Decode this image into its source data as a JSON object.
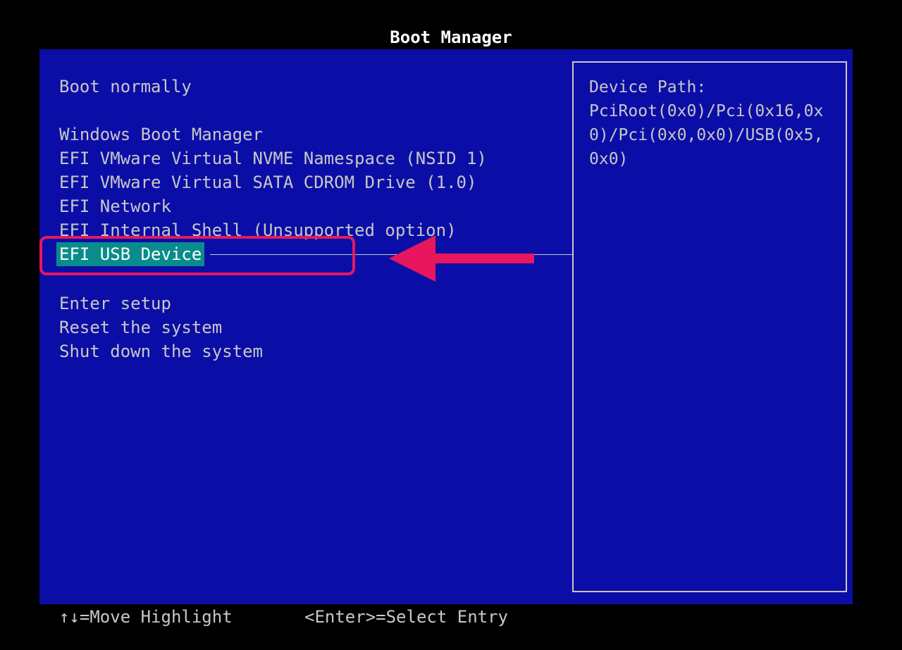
{
  "title": "Boot Manager",
  "menu": {
    "items": [
      {
        "label": "Boot normally"
      },
      {
        "label": "Windows Boot Manager"
      },
      {
        "label": "EFI VMware Virtual NVME Namespace (NSID 1)"
      },
      {
        "label": "EFI VMware Virtual SATA CDROM Drive (1.0)"
      },
      {
        "label": "EFI Network"
      },
      {
        "label": "EFI Internal Shell (Unsupported option)"
      },
      {
        "label": "EFI USB Device"
      },
      {
        "label": "Enter setup"
      },
      {
        "label": "Reset the system"
      },
      {
        "label": "Shut down the system"
      }
    ],
    "selected_label": "EFI USB Device"
  },
  "detail": {
    "text": "Device Path:\nPciRoot(0x0)/Pci(0x16,0x\n0)/Pci(0x0,0x0)/USB(0x5,\n0x0)"
  },
  "footer": {
    "move_hint": "↑↓=Move Highlight",
    "select_hint": "<Enter>=Select Entry"
  },
  "colors": {
    "background": "#0b0ea6",
    "selected_background": "#0a8c8c",
    "annotation": "#e8175d"
  },
  "annotation": {
    "arrow_icon": "left-arrow-icon"
  }
}
